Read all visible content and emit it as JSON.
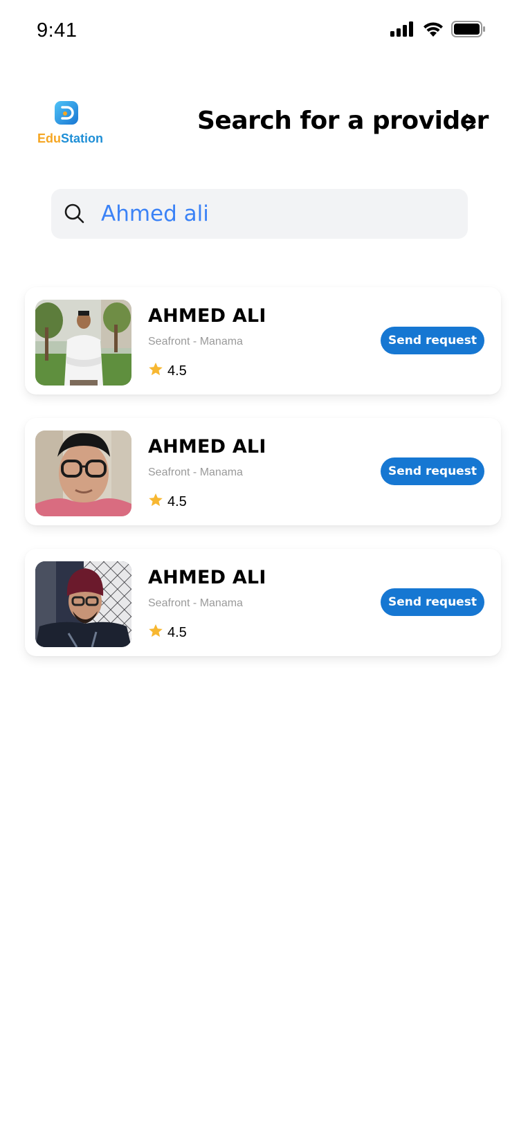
{
  "status_bar": {
    "time": "9:41"
  },
  "header": {
    "logo_edu": "Edu",
    "logo_station": "Station",
    "title": "Search for a provider"
  },
  "search": {
    "value": "Ahmed ali"
  },
  "providers": [
    {
      "name": "AHMED ALI",
      "location": "Seafront - Manama",
      "rating": "4.5",
      "button_label": "Send request"
    },
    {
      "name": "AHMED ALI",
      "location": "Seafront - Manama",
      "rating": "4.5",
      "button_label": "Send request"
    },
    {
      "name": "AHMED ALI",
      "location": "Seafront - Manama",
      "rating": "4.5",
      "button_label": "Send request"
    }
  ],
  "colors": {
    "primary_button": "#1677d2",
    "search_text": "#3b82f6",
    "star": "#f7b731",
    "logo_orange": "#f5a623",
    "logo_blue": "#1f8fd6"
  },
  "icons": {
    "signal": "cellular-signal-icon",
    "wifi": "wifi-icon",
    "battery": "battery-icon",
    "chevron": "chevron-right-icon",
    "search": "search-icon",
    "star": "star-icon"
  }
}
